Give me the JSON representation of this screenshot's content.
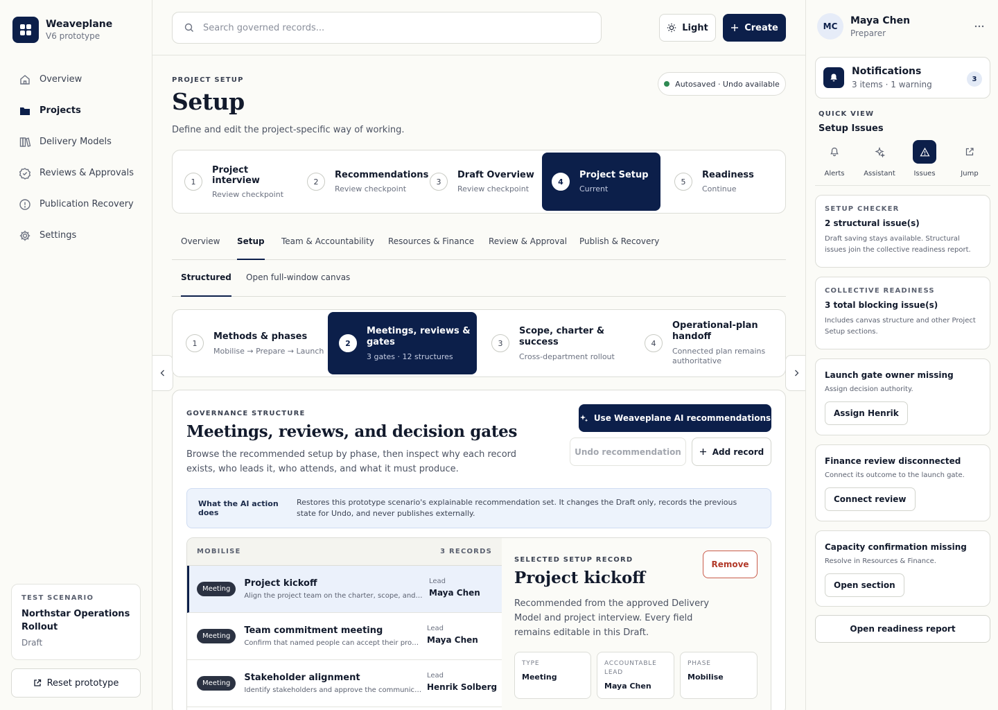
{
  "app": {
    "name": "Weaveplane",
    "subtitle": "V6 prototype"
  },
  "nav": [
    {
      "label": "Overview",
      "icon": "home-icon"
    },
    {
      "label": "Projects",
      "icon": "folder-icon",
      "active": true
    },
    {
      "label": "Delivery Models",
      "icon": "books-icon"
    },
    {
      "label": "Reviews & Approvals",
      "icon": "check-badge-icon"
    },
    {
      "label": "Publication Recovery",
      "icon": "alert-circle-icon"
    },
    {
      "label": "Settings",
      "icon": "gear-icon"
    }
  ],
  "scenario": {
    "eyebrow": "TEST SCENARIO",
    "name": "Northstar Operations Rollout",
    "status": "Draft",
    "reset_label": "Reset prototype"
  },
  "topbar": {
    "search_placeholder": "Search governed records...",
    "light_label": "Light",
    "create_label": "Create"
  },
  "page": {
    "eyebrow": "PROJECT SETUP",
    "title": "Setup",
    "description": "Define and edit the project-specific way of working.",
    "autosave": "Autosaved · Undo available"
  },
  "steps": [
    {
      "num": "1",
      "label": "Project interview",
      "sub": "Review checkpoint"
    },
    {
      "num": "2",
      "label": "Recommendations",
      "sub": "Review checkpoint"
    },
    {
      "num": "3",
      "label": "Draft Overview",
      "sub": "Review checkpoint"
    },
    {
      "num": "4",
      "label": "Project Setup",
      "sub": "Current",
      "active": true
    },
    {
      "num": "5",
      "label": "Readiness",
      "sub": "Continue"
    }
  ],
  "tabs": [
    "Overview",
    "Setup",
    "Team & Accountability",
    "Resources & Finance",
    "Review & Approval",
    "Publish & Recovery"
  ],
  "subtabs": [
    "Structured",
    "Open full-window canvas"
  ],
  "substeps": [
    {
      "num": "1",
      "label": "Methods & phases",
      "sub": "Mobilise → Prepare → Launch"
    },
    {
      "num": "2",
      "label": "Meetings, reviews & gates",
      "sub": "3 gates · 12 structures",
      "active": true
    },
    {
      "num": "3",
      "label": "Scope, charter & success",
      "sub": "Cross-department rollout"
    },
    {
      "num": "4",
      "label": "Operational-plan handoff",
      "sub": "Connected plan remains authoritative"
    }
  ],
  "governance": {
    "eyebrow": "GOVERNANCE STRUCTURE",
    "title": "Meetings, reviews, and decision gates",
    "description": "Browse the recommended setup by phase, then inspect why each record exists, who leads it, who attends, and what it must produce.",
    "ai_button": "Use Weaveplane AI recommendations",
    "undo_button": "Undo recommendation",
    "add_button": "Add record",
    "ai_note_label": "What the AI action does",
    "ai_note_text": "Restores this prototype scenario's explainable recommendation set. It changes the Draft only, records the previous state for Undo, and never publishes externally."
  },
  "records": {
    "phase": "MOBILISE",
    "count": "3 RECORDS",
    "lead_label": "Lead",
    "items": [
      {
        "type": "Meeting",
        "title": "Project kickoff",
        "desc": "Align the project team on the charter, scope, and launch plan.",
        "lead": "Maya Chen",
        "selected": true
      },
      {
        "type": "Meeting",
        "title": "Team commitment meeting",
        "desc": "Confirm that named people can accept their proposed roles.",
        "lead": "Maya Chen"
      },
      {
        "type": "Meeting",
        "title": "Stakeholder alignment",
        "desc": "Identify stakeholders and approve the communication plan.",
        "lead": "Henrik Solberg"
      }
    ]
  },
  "detail": {
    "eyebrow": "SELECTED SETUP RECORD",
    "title": "Project kickoff",
    "remove_label": "Remove",
    "description": "Recommended from the approved Delivery Model and project interview. Every field remains editable in this Draft.",
    "fields": [
      {
        "label": "TYPE",
        "value": "Meeting"
      },
      {
        "label": "ACCOUNTABLE LEAD",
        "value": "Maya Chen"
      },
      {
        "label": "PHASE",
        "value": "Mobilise"
      }
    ]
  },
  "user": {
    "initials": "MC",
    "name": "Maya Chen",
    "role": "Preparer"
  },
  "notifications": {
    "title": "Notifications",
    "sub": "3 items · 1 warning",
    "count": "3"
  },
  "quickview": {
    "eyebrow": "QUICK VIEW",
    "title": "Setup Issues",
    "items": [
      {
        "label": "Alerts",
        "icon": "bell-icon"
      },
      {
        "label": "Assistant",
        "icon": "sparkle-icon"
      },
      {
        "label": "Issues",
        "icon": "warning-icon",
        "active": true
      },
      {
        "label": "Jump",
        "icon": "external-link-icon"
      }
    ]
  },
  "cards": {
    "checker": {
      "eyebrow": "SETUP CHECKER",
      "title": "2 structural issue(s)",
      "text": "Draft saving stays available. Structural issues join the collective readiness report."
    },
    "readiness": {
      "eyebrow": "COLLECTIVE READINESS",
      "title": "3 total blocking issue(s)",
      "text": "Includes canvas structure and other Project Setup sections."
    },
    "issues": [
      {
        "title": "Launch gate owner missing",
        "text": "Assign decision authority.",
        "button": "Assign Henrik"
      },
      {
        "title": "Finance review disconnected",
        "text": "Connect its outcome to the launch gate.",
        "button": "Connect review"
      },
      {
        "title": "Capacity confirmation missing",
        "text": "Resolve in Resources & Finance.",
        "button": "Open section"
      }
    ],
    "readiness_button": "Open readiness report"
  }
}
